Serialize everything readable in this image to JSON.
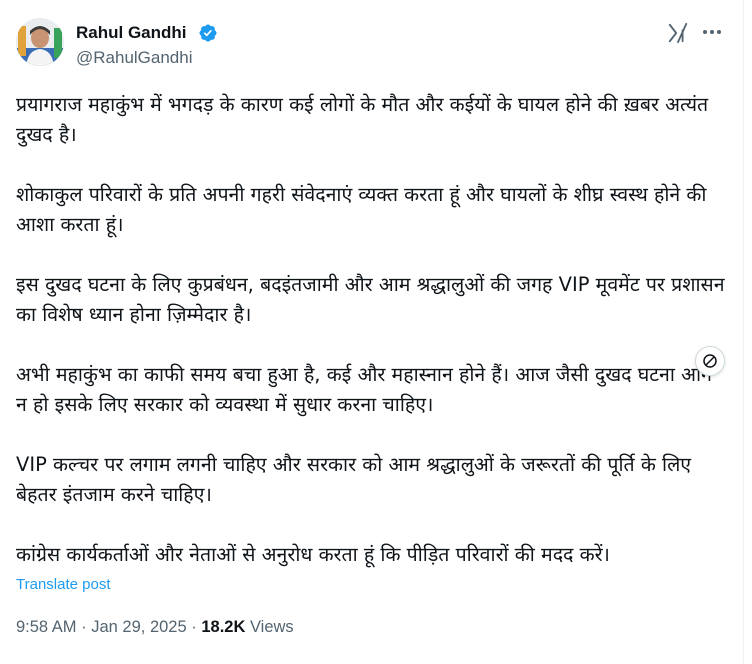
{
  "author": {
    "name": "Rahul Gandhi",
    "handle": "@RahulGandhi",
    "verified_icon": "verified-badge-icon",
    "badge_color": "#1d9bf0"
  },
  "header_actions": {
    "grok_icon": "grok-icon",
    "more_icon": "more-horizontal-icon"
  },
  "post": {
    "paragraphs": [
      "प्रयागराज महाकुंभ में भगदड़ के कारण कई लोगों के मौत और कईयों के घायल होने की ख़बर अत्यंत दुखद है।",
      "शोकाकुल परिवारों के प्रति अपनी गहरी संवेदनाएं व्यक्त करता हूं और घायलों के शीघ्र स्वस्थ होने की आशा करता हूं।",
      "इस दुखद घटना के लिए कुप्रबंधन, बदइंतजामी और आम श्रद्धालुओं की जगह VIP मूवमेंट पर प्रशासन का विशेष ध्यान होना ज़िम्मेदार है।",
      "अभी महाकुंभ का काफी समय बचा हुआ है, कई और महास्नान होने हैं। आज जैसी दुखद घटना आगे न हो इसके लिए सरकार को व्यवस्था में सुधार करना चाहिए।",
      "VIP कल्चर पर लगाम लगनी चाहिए और सरकार को आम श्रद्धालुओं के जरूरतों की पूर्ति के लिए बेहतर इंतजाम करने चाहिए।",
      "कांग्रेस कार्यकर्ताओं और नेताओं से अनुरोध करता हूं कि पीड़ित परिवारों की मदद करें।"
    ],
    "translate_label": "Translate post",
    "time": "9:58 AM",
    "separator": "·",
    "date": "Jan 29, 2025",
    "views_count": "18.2K",
    "views_label": "Views",
    "link_color": "#1d9bf0"
  },
  "floating_button": {
    "icon": "no-entry-icon"
  }
}
